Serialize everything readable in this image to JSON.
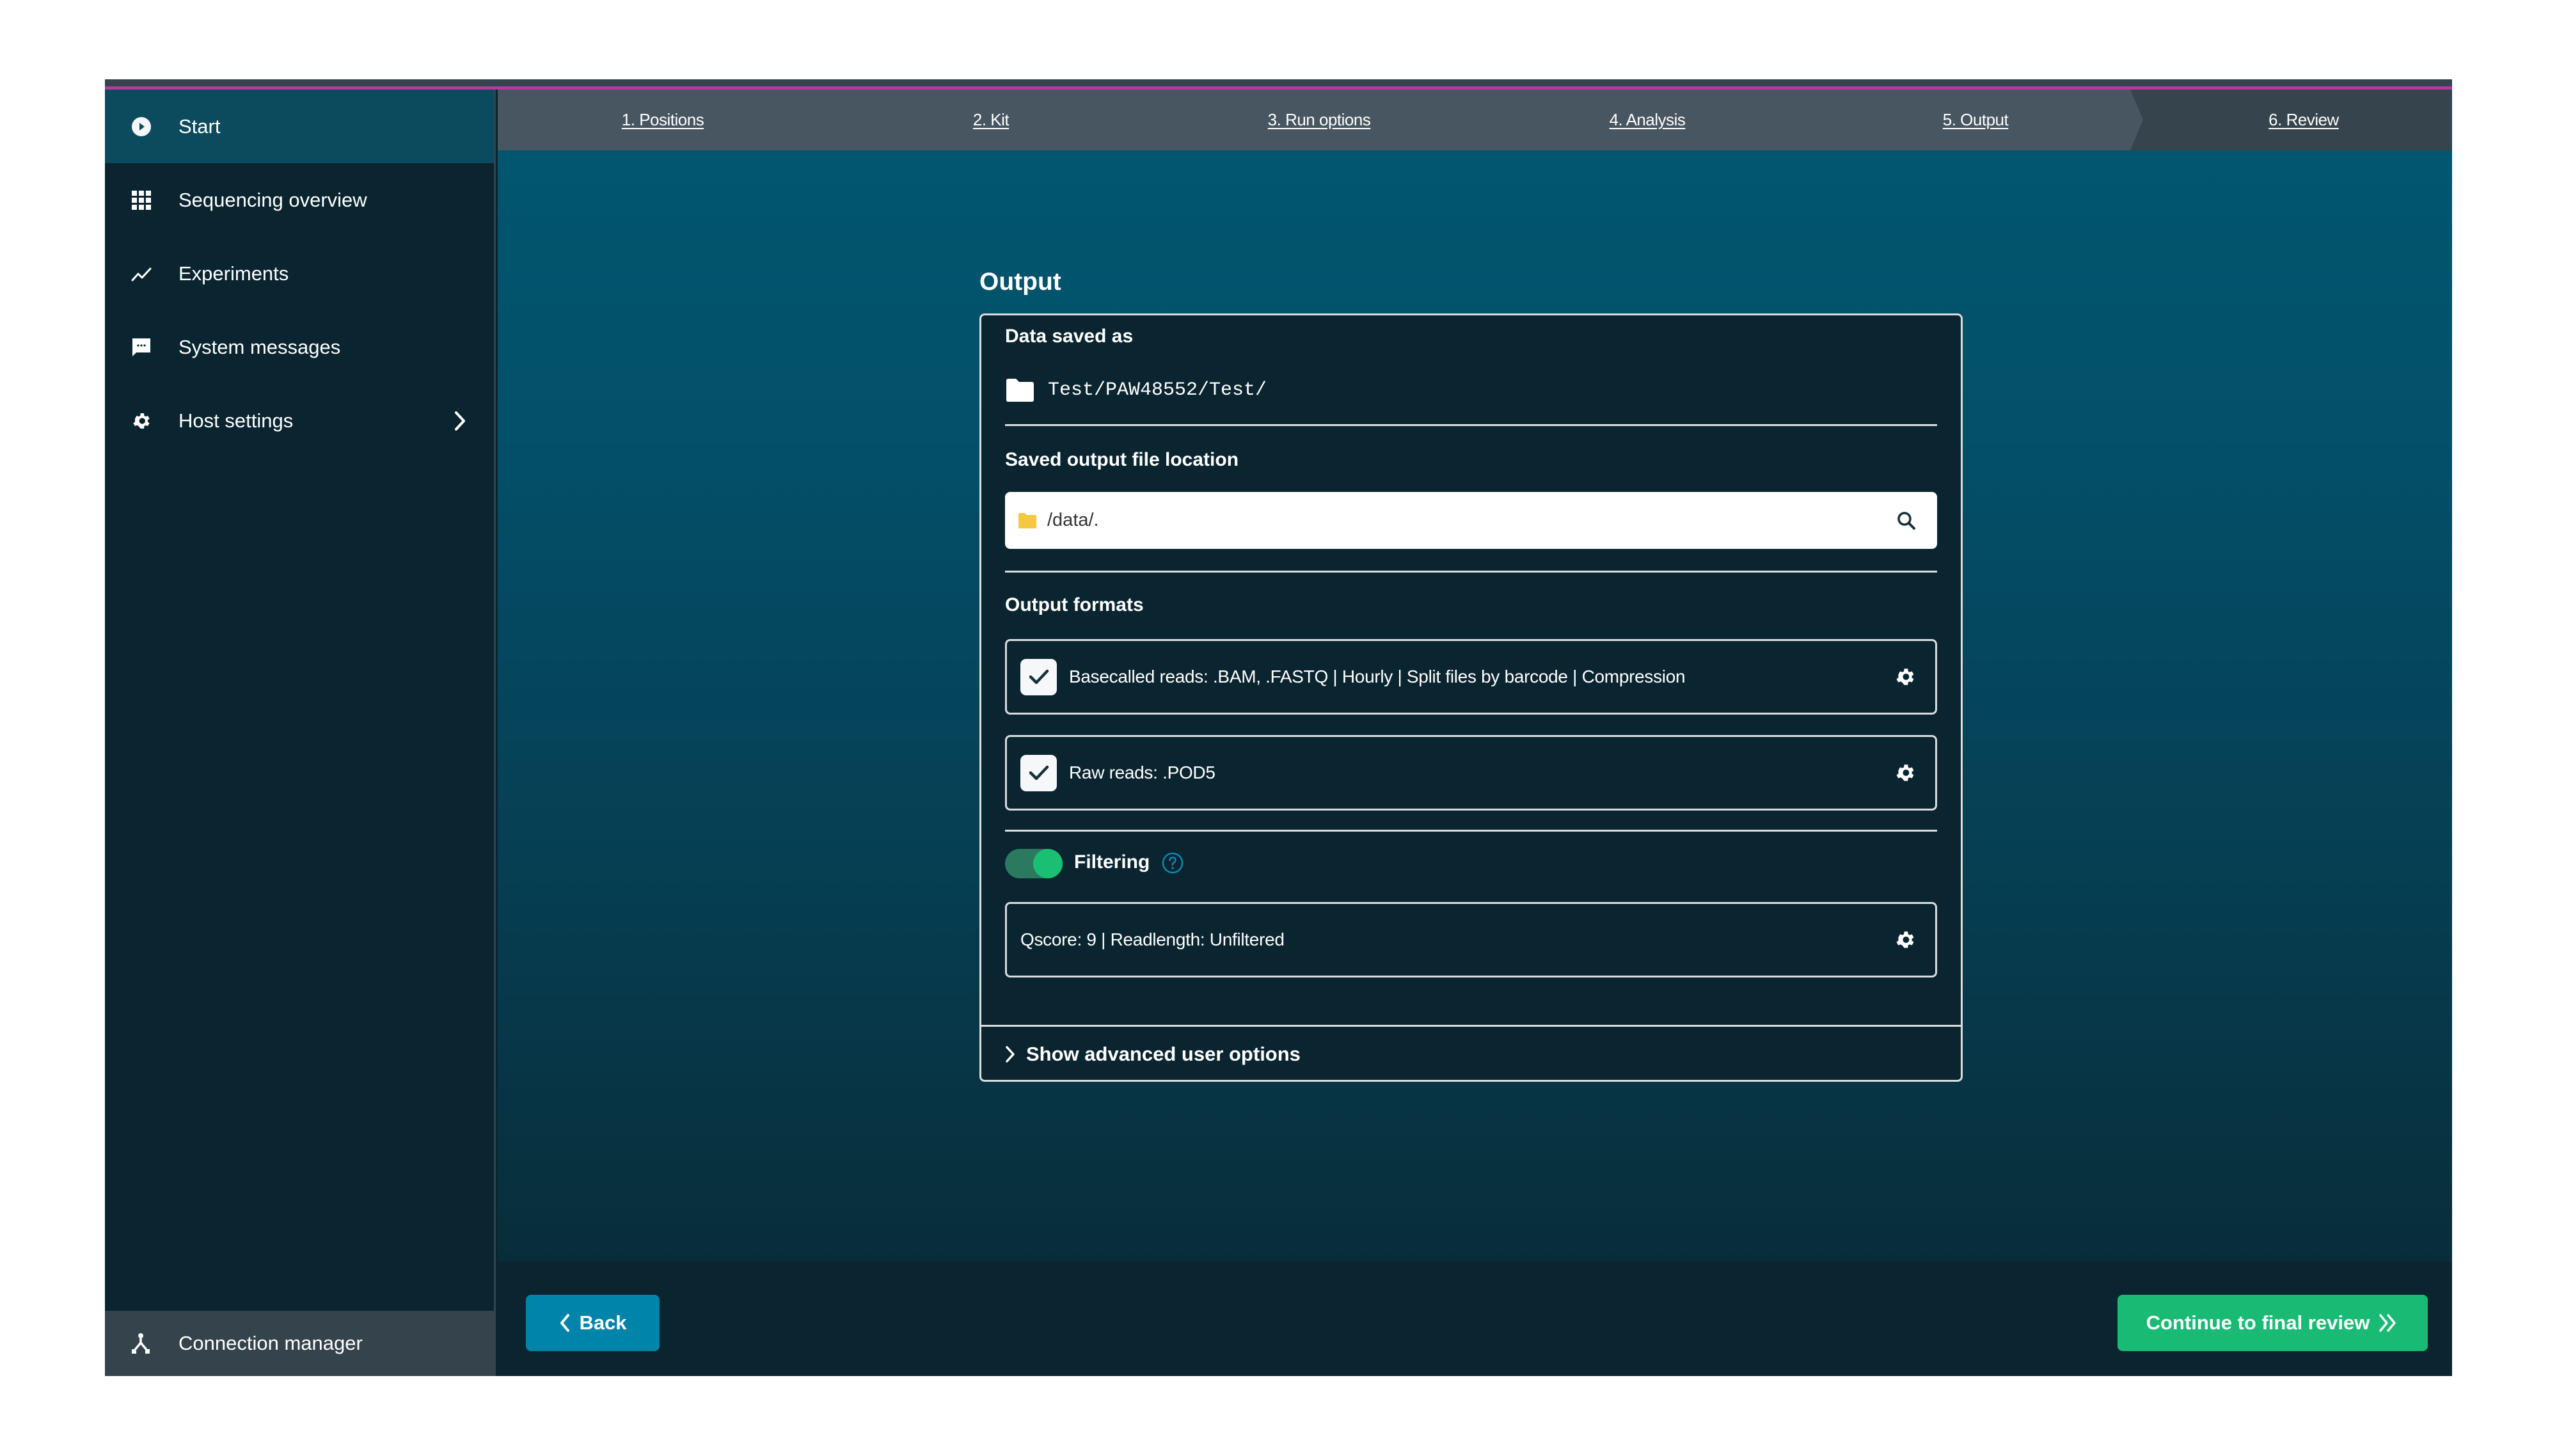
{
  "colors": {
    "magenta_accent": "#b23c9e",
    "sidebar_bg": "#0a2530",
    "sidebar_active_bg": "#0c4b5e",
    "stepper_done_bg": "#475660",
    "stepper_current_bg": "#35444d",
    "primary_button": "#0184aa",
    "success_button": "#19bb74",
    "toggle_on": "#1bbf74",
    "help_icon": "#0a8ab0"
  },
  "sidebar": {
    "items": [
      {
        "label": "Start",
        "icon": "play-circle-icon",
        "active": true
      },
      {
        "label": "Sequencing overview",
        "icon": "grid-icon"
      },
      {
        "label": "Experiments",
        "icon": "line-chart-icon"
      },
      {
        "label": "System messages",
        "icon": "message-icon"
      },
      {
        "label": "Host settings",
        "icon": "gear-icon",
        "has_submenu": true
      }
    ],
    "footer": {
      "label": "Connection manager",
      "icon": "connection-icon"
    }
  },
  "stepper": {
    "steps": [
      {
        "label": "1. Positions"
      },
      {
        "label": "2. Kit"
      },
      {
        "label": "3. Run options"
      },
      {
        "label": "4. Analysis"
      },
      {
        "label": "5. Output",
        "current": true
      },
      {
        "label": "6. Review"
      }
    ]
  },
  "main": {
    "title": "Output",
    "data_saved_as": {
      "label": "Data saved as",
      "path": "Test/PAW48552/Test/"
    },
    "output_location": {
      "label": "Saved output file location",
      "value": "/data/."
    },
    "output_formats": {
      "label": "Output formats",
      "items": [
        {
          "label": "Basecalled reads: .BAM, .FASTQ | Hourly | Split files by barcode | Compression",
          "checked": true
        },
        {
          "label": "Raw reads: .POD5",
          "checked": true
        }
      ]
    },
    "filtering": {
      "label": "Filtering",
      "enabled": true,
      "summary": "Qscore: 9 | Readlength: Unfiltered"
    },
    "advanced": {
      "label": "Show advanced user options"
    }
  },
  "footer": {
    "back_label": "Back",
    "continue_label": "Continue to final review"
  }
}
